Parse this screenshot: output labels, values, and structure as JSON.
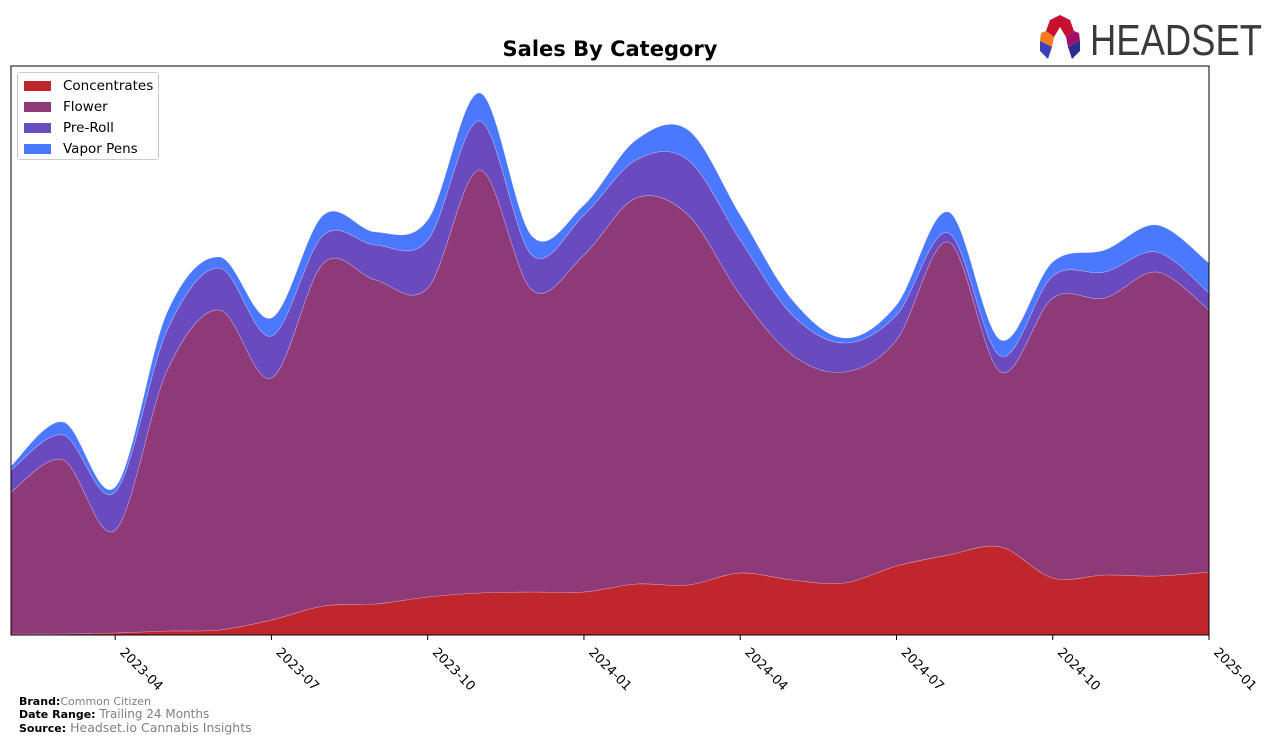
{
  "header": {
    "logo_text": "HEADSET"
  },
  "chart_data": {
    "type": "area",
    "stacked": true,
    "smooth": true,
    "title": "Sales By Category",
    "xlabel": "",
    "ylabel": "",
    "x": [
      "2023-02",
      "2023-03",
      "2023-04",
      "2023-05",
      "2023-06",
      "2023-07",
      "2023-08",
      "2023-09",
      "2023-10",
      "2023-11",
      "2023-12",
      "2024-01",
      "2024-02",
      "2024-03",
      "2024-04",
      "2024-05",
      "2024-06",
      "2024-07",
      "2024-08",
      "2024-09",
      "2024-10",
      "2024-11",
      "2024-12",
      "2025-01"
    ],
    "x_ticks": [
      "2023-04",
      "2023-07",
      "2023-10",
      "2024-01",
      "2024-04",
      "2024-07",
      "2024-10",
      "2025-01"
    ],
    "ylim": [
      0,
      569
    ],
    "y_ticks_visible": false,
    "grid": false,
    "legend_position": "top-left",
    "series": [
      {
        "name": "Concentrates",
        "color": "#c0272d",
        "values": [
          1,
          1,
          2,
          4,
          5,
          15,
          29,
          31,
          38,
          42,
          43,
          43,
          51,
          50,
          62,
          55,
          52,
          69,
          80,
          88,
          57,
          60,
          59,
          63
        ]
      },
      {
        "name": "Flower",
        "color": "#8f3a78",
        "values": [
          142,
          174,
          103,
          261,
          320,
          242,
          343,
          324,
          309,
          423,
          302,
          337,
          386,
          370,
          278,
          225,
          211,
          226,
          313,
          175,
          280,
          277,
          304,
          262
        ]
      },
      {
        "name": "Pre-Roll",
        "color": "#6a4abf",
        "values": [
          22,
          25,
          38,
          40,
          42,
          42,
          28,
          35,
          48,
          49,
          35,
          40,
          38,
          55,
          55,
          40,
          29,
          25,
          9,
          16,
          22,
          26,
          20,
          17
        ]
      },
      {
        "name": "Vapor Pens",
        "color": "#4a78ff",
        "values": [
          4,
          13,
          5,
          18,
          11,
          18,
          20,
          13,
          20,
          28,
          19,
          10,
          20,
          30,
          25,
          15,
          5,
          10,
          21,
          16,
          14,
          22,
          27,
          30
        ]
      }
    ]
  },
  "footer": {
    "brand_label": "Brand:",
    "brand_value": "Common Citizen",
    "date_range_label": "Date Range:",
    "date_range_value": "Trailing 24 Months",
    "source_label": "Source:",
    "source_value": "Headset.io Cannabis Insights"
  }
}
